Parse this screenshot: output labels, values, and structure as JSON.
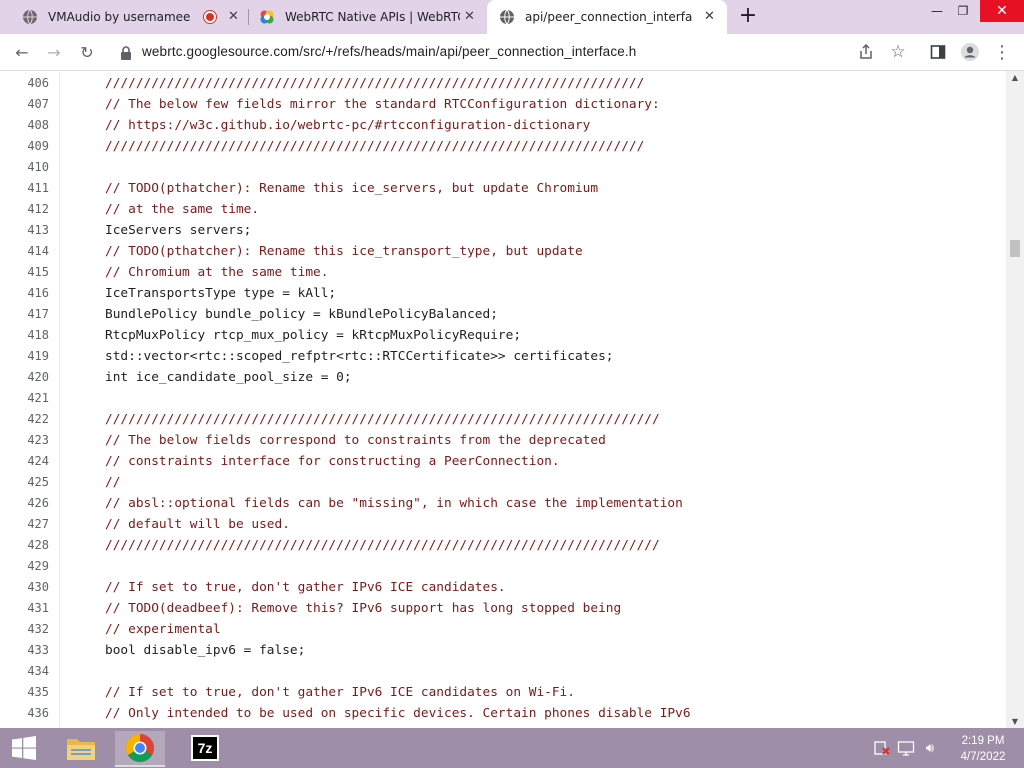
{
  "browser": {
    "tabs": [
      {
        "title": "VMAudio by usernamee",
        "icon": "globe-icon",
        "recording_indicator": true
      },
      {
        "title": "WebRTC Native APIs | WebRTC",
        "icon": "webrtc-icon"
      },
      {
        "title": "api/peer_connection_interface.h",
        "icon": "globe-icon",
        "active": true
      }
    ],
    "new_tab_label": "+",
    "url": "webrtc.googlesource.com/src/+/refs/heads/main/api/peer_connection_interface.h"
  },
  "code_lines": [
    {
      "num": "406",
      "text": "//////////////////////////////////////////////////////////////////////",
      "kind": "comment"
    },
    {
      "num": "407",
      "text": "// The below few fields mirror the standard RTCConfiguration dictionary:",
      "kind": "comment"
    },
    {
      "num": "408",
      "text": "// https://w3c.github.io/webrtc-pc/#rtcconfiguration-dictionary",
      "kind": "comment"
    },
    {
      "num": "409",
      "text": "//////////////////////////////////////////////////////////////////////",
      "kind": "comment"
    },
    {
      "num": "410",
      "text": "",
      "kind": "plain"
    },
    {
      "num": "411",
      "text": "// TODO(pthatcher): Rename this ice_servers, but update Chromium",
      "kind": "comment"
    },
    {
      "num": "412",
      "text": "// at the same time.",
      "kind": "comment"
    },
    {
      "num": "413",
      "text": "IceServers servers;",
      "kind": "plain"
    },
    {
      "num": "414",
      "text": "// TODO(pthatcher): Rename this ice_transport_type, but update",
      "kind": "comment"
    },
    {
      "num": "415",
      "text": "// Chromium at the same time.",
      "kind": "comment"
    },
    {
      "num": "416",
      "text": "IceTransportsType type = kAll;",
      "kind": "plain"
    },
    {
      "num": "417",
      "text": "BundlePolicy bundle_policy = kBundlePolicyBalanced;",
      "kind": "plain"
    },
    {
      "num": "418",
      "text": "RtcpMuxPolicy rtcp_mux_policy = kRtcpMuxPolicyRequire;",
      "kind": "plain"
    },
    {
      "num": "419",
      "text": "std::vector<rtc::scoped_refptr<rtc::RTCCertificate>> certificates;",
      "kind": "plain"
    },
    {
      "num": "420",
      "text": "int ice_candidate_pool_size = 0;",
      "kind": "plain"
    },
    {
      "num": "421",
      "text": "",
      "kind": "plain"
    },
    {
      "num": "422",
      "text": "////////////////////////////////////////////////////////////////////////",
      "kind": "comment"
    },
    {
      "num": "423",
      "text": "// The below fields correspond to constraints from the deprecated",
      "kind": "comment"
    },
    {
      "num": "424",
      "text": "// constraints interface for constructing a PeerConnection.",
      "kind": "comment"
    },
    {
      "num": "425",
      "text": "//",
      "kind": "comment"
    },
    {
      "num": "426",
      "text": "// absl::optional fields can be \"missing\", in which case the implementation",
      "kind": "comment"
    },
    {
      "num": "427",
      "text": "// default will be used.",
      "kind": "comment"
    },
    {
      "num": "428",
      "text": "////////////////////////////////////////////////////////////////////////",
      "kind": "comment"
    },
    {
      "num": "429",
      "text": "",
      "kind": "plain"
    },
    {
      "num": "430",
      "text": "// If set to true, don't gather IPv6 ICE candidates.",
      "kind": "comment"
    },
    {
      "num": "431",
      "text": "// TODO(deadbeef): Remove this? IPv6 support has long stopped being",
      "kind": "comment"
    },
    {
      "num": "432",
      "text": "// experimental",
      "kind": "comment"
    },
    {
      "num": "433",
      "text": "bool disable_ipv6 = false;",
      "kind": "plain"
    },
    {
      "num": "434",
      "text": "",
      "kind": "plain"
    },
    {
      "num": "435",
      "text": "// If set to true, don't gather IPv6 ICE candidates on Wi-Fi.",
      "kind": "comment"
    },
    {
      "num": "436",
      "text": "// Only intended to be used on specific devices. Certain phones disable IPv6",
      "kind": "comment"
    }
  ],
  "scrollbar": {
    "position_fraction": 0.25
  },
  "taskbar": {
    "apps": [
      "start-button",
      "file-explorer",
      "chrome",
      "7-zip"
    ],
    "sevenzip_label": "7z",
    "clock_time": "2:19 PM",
    "clock_date": "4/7/2022"
  },
  "colors": {
    "titlebar": "#e3d3e9",
    "taskbar": "#9e8ea7",
    "comment": "#7a1a1a",
    "plain_code": "#1f1f1f",
    "line_number": "#5f6368"
  }
}
